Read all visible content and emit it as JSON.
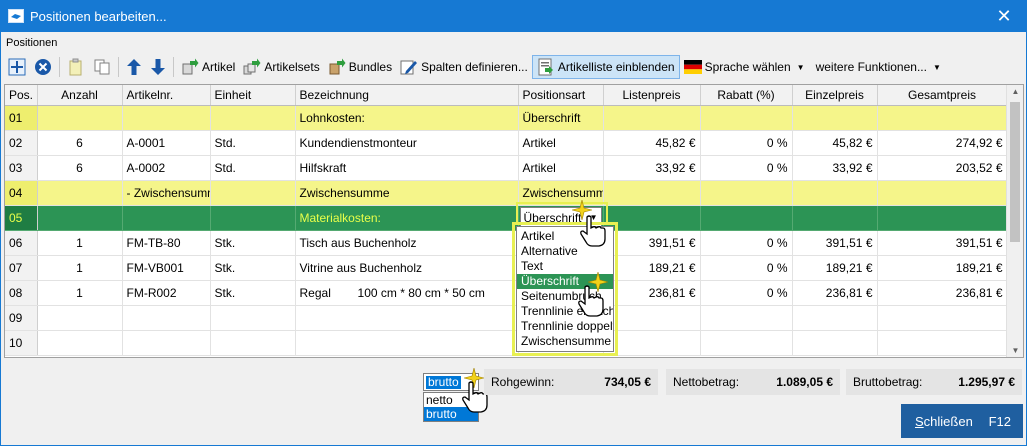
{
  "window": {
    "title": "Positionen bearbeiten...",
    "close": "✕"
  },
  "section_label": "Positionen",
  "toolbar": {
    "artikel": "Artikel",
    "artikelsets": "Artikelsets",
    "bundles": "Bundles",
    "spalten": "Spalten definieren...",
    "artikelliste": "Artikelliste einblenden",
    "sprache": "Sprache wählen",
    "weitere": "weitere Funktionen..."
  },
  "grid": {
    "headers": [
      "Pos.",
      "Anzahl",
      "Artikelnr.",
      "Einheit",
      "Bezeichnung",
      "Positionsart",
      "Listenpreis",
      "Rabatt (%)",
      "Einzelpreis",
      "Gesamtpreis"
    ],
    "rows": [
      {
        "pos": "01",
        "anzahl": "",
        "artikelnr": "",
        "einheit": "",
        "bezeichnung": "Lohnkosten:",
        "positionsart": "Überschrift",
        "listenpreis": "",
        "rabatt": "",
        "einzelpreis": "",
        "gesamtpreis": ""
      },
      {
        "pos": "02",
        "anzahl": "6",
        "artikelnr": "A-0001",
        "einheit": "Std.",
        "bezeichnung": "Kundendienstmonteur",
        "positionsart": "Artikel",
        "listenpreis": "45,82 €",
        "rabatt": "0 %",
        "einzelpreis": "45,82 €",
        "gesamtpreis": "274,92 €"
      },
      {
        "pos": "03",
        "anzahl": "6",
        "artikelnr": "A-0002",
        "einheit": "Std.",
        "bezeichnung": "Hilfskraft",
        "positionsart": "Artikel",
        "listenpreis": "33,92 €",
        "rabatt": "0 %",
        "einzelpreis": "33,92 €",
        "gesamtpreis": "203,52 €"
      },
      {
        "pos": "04",
        "anzahl": "",
        "artikelnr": "- Zwischensumm...",
        "einheit": "",
        "bezeichnung": "Zwischensumme",
        "positionsart": "Zwischensumme",
        "listenpreis": "",
        "rabatt": "",
        "einzelpreis": "",
        "gesamtpreis": ""
      },
      {
        "pos": "05",
        "anzahl": "",
        "artikelnr": "",
        "einheit": "",
        "bezeichnung": "Materialkosten:",
        "positionsart": "Überschrift",
        "listenpreis": "",
        "rabatt": "",
        "einzelpreis": "",
        "gesamtpreis": ""
      },
      {
        "pos": "06",
        "anzahl": "1",
        "artikelnr": "FM-TB-80",
        "einheit": "Stk.",
        "bezeichnung": "Tisch aus Buchenholz",
        "positionsart": "",
        "listenpreis": "391,51 €",
        "rabatt": "0 %",
        "einzelpreis": "391,51 €",
        "gesamtpreis": "391,51 €"
      },
      {
        "pos": "07",
        "anzahl": "1",
        "artikelnr": "FM-VB001",
        "einheit": "Stk.",
        "bezeichnung": "Vitrine aus Buchenholz",
        "positionsart": "",
        "listenpreis": "189,21 €",
        "rabatt": "0 %",
        "einzelpreis": "189,21 €",
        "gesamtpreis": "189,21 €"
      },
      {
        "pos": "08",
        "anzahl": "1",
        "artikelnr": "FM-R002",
        "einheit": "Stk.",
        "bezeichnung": "Regal        100 cm * 80 cm * 50 cm",
        "positionsart": "",
        "listenpreis": "236,81 €",
        "rabatt": "0 %",
        "einzelpreis": "236,81 €",
        "gesamtpreis": "236,81 €"
      },
      {
        "pos": "09",
        "anzahl": "",
        "artikelnr": "",
        "einheit": "",
        "bezeichnung": "",
        "positionsart": "",
        "listenpreis": "",
        "rabatt": "",
        "einzelpreis": "",
        "gesamtpreis": ""
      },
      {
        "pos": "10",
        "anzahl": "",
        "artikelnr": "",
        "einheit": "",
        "bezeichnung": "",
        "positionsart": "",
        "listenpreis": "",
        "rabatt": "",
        "einzelpreis": "",
        "gesamtpreis": ""
      }
    ]
  },
  "positionsart_dropdown": {
    "current": "Überschrift",
    "options": [
      "Artikel",
      "Alternative",
      "Text",
      "Überschrift",
      "Seitenumbruch",
      "Trennlinie einfach",
      "Trennlinie doppelt",
      "Zwischensumme"
    ],
    "selected_index": 3
  },
  "summary": {
    "mode_selected": "brutto",
    "mode_options": [
      "netto",
      "brutto"
    ],
    "rohgewinn_label": "Rohgewinn:",
    "rohgewinn_value": "734,05 €",
    "netto_label": "Nettobetrag:",
    "netto_value": "1.089,05 €",
    "brutto_label": "Bruttobetrag:",
    "brutto_value": "1.295,97 €"
  },
  "close_button": {
    "label_underlined": "S",
    "label_rest": "chließen",
    "shortcut": "F12"
  },
  "colors": {
    "titlebar": "#1679d3",
    "highlight_yellow": "#f5f58a",
    "selected_green": "#2c9455",
    "close_button": "#1f5fa0"
  }
}
